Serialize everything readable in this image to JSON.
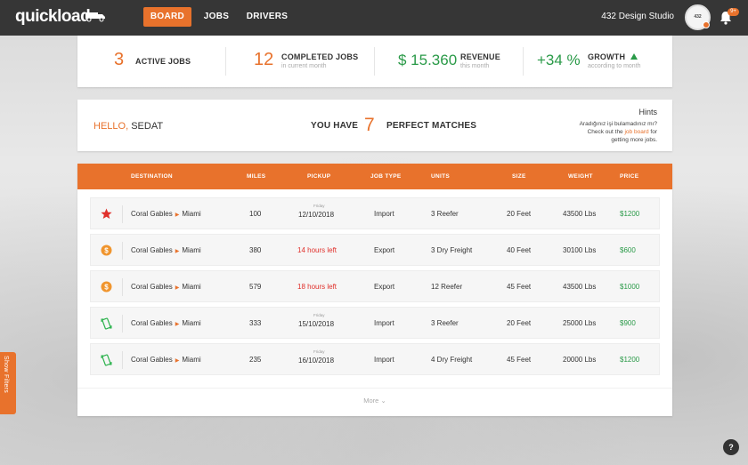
{
  "app": {
    "logo": "quickload",
    "nav": [
      {
        "label": "BOARD",
        "active": true
      },
      {
        "label": "JOBS",
        "active": false
      },
      {
        "label": "DRIVERS",
        "active": false
      }
    ],
    "studio": "432 Design Studio",
    "avatar_text": "432",
    "notification_badge": "9+",
    "accent_color": "#e8722c"
  },
  "stats": {
    "active": {
      "value": "3",
      "label": "ACTIVE JOBS"
    },
    "completed": {
      "value": "12",
      "label": "COMPLETED JOBS",
      "sub": "in current month"
    },
    "revenue": {
      "value": "$ 15.360",
      "label": "REVENUE",
      "sub": "this month"
    },
    "growth": {
      "value": "+34 %",
      "label": "GROWTH",
      "sub": "according to month"
    }
  },
  "hello": {
    "greeting": "HELLO,",
    "name": "SEDAT",
    "you_have": "YOU HAVE",
    "matches": "7",
    "perfect_matches": "PERFECT MATCHES",
    "hints_title": "Hints",
    "hints_line1": "Aradığınız işi bulamadınız mı?",
    "hints_line2_pre": "Check out the ",
    "hints_link": "job board",
    "hints_line2_post": " for",
    "hints_line3": "getting more jobs."
  },
  "table": {
    "headers": [
      "DESTINATION",
      "MILES",
      "PICKUP",
      "JOB TYPE",
      "UNITS",
      "SIZE",
      "WEIGHT",
      "PRICE"
    ],
    "rows": [
      {
        "icon": "star-icon",
        "from": "Coral Gables",
        "to": "Miami",
        "miles": "100",
        "pickup_day": "Friday",
        "pickup": "12/10/2018",
        "pickup_urgent": false,
        "job_type": "Import",
        "units": "3 Reefer",
        "size": "20 Feet",
        "weight": "43500 Lbs",
        "price": "$1200"
      },
      {
        "icon": "dollar-coin-icon",
        "from": "Coral Gables",
        "to": "Miami",
        "miles": "380",
        "pickup_day": "",
        "pickup": "14 hours left",
        "pickup_urgent": true,
        "job_type": "Export",
        "units": "3 Dry Freight",
        "size": "40 Feet",
        "weight": "30100 Lbs",
        "price": "$600"
      },
      {
        "icon": "dollar-coin-icon",
        "from": "Coral Gables",
        "to": "Miami",
        "miles": "579",
        "pickup_day": "",
        "pickup": "18 hours left",
        "pickup_urgent": true,
        "job_type": "Export",
        "units": "12 Reefer",
        "size": "45 Feet",
        "weight": "43500 Lbs",
        "price": "$1000"
      },
      {
        "icon": "mobile-rotate-icon",
        "from": "Coral Gables",
        "to": "Miami",
        "miles": "333",
        "pickup_day": "Friday",
        "pickup": "15/10/2018",
        "pickup_urgent": false,
        "job_type": "Import",
        "units": "3 Reefer",
        "size": "20 Feet",
        "weight": "25000 Lbs",
        "price": "$900"
      },
      {
        "icon": "mobile-rotate-icon",
        "from": "Coral Gables",
        "to": "Miami",
        "miles": "235",
        "pickup_day": "Friday",
        "pickup": "16/10/2018",
        "pickup_urgent": false,
        "job_type": "Import",
        "units": "4 Dry Freight",
        "size": "45 Feet",
        "weight": "20000 Lbs",
        "price": "$1200"
      }
    ],
    "more_label": "More"
  },
  "side_tab": "Show Filters",
  "help_label": "?"
}
